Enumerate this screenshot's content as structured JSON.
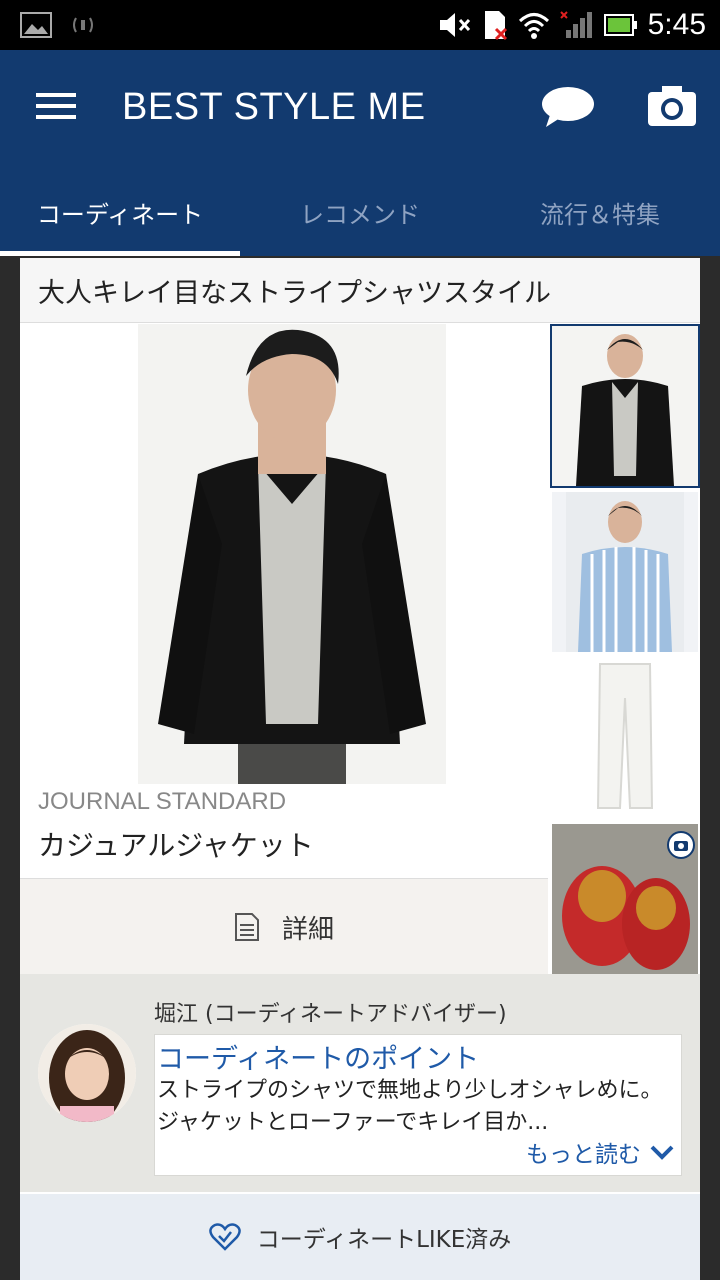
{
  "status_bar": {
    "time": "5:45"
  },
  "app": {
    "title": "BEST STYLE ME"
  },
  "tabs": [
    {
      "label": "コーディネート",
      "active": true
    },
    {
      "label": "レコメンド",
      "active": false
    },
    {
      "label": "流行＆特集",
      "active": false
    }
  ],
  "coordinate": {
    "title": "大人キレイ目なストライプシャツスタイル",
    "item": {
      "brand": "JOURNAL STANDARD",
      "name": "カジュアルジャケット"
    },
    "detail_label": "詳細",
    "thumbnails": [
      "jacket",
      "striped-shirt",
      "white-pants",
      "red-loafers"
    ]
  },
  "advisor": {
    "name": "堀江 (コーディネートアドバイザー)",
    "tip_heading": "コーディネートのポイント",
    "tip_text": "ストライプのシャツで無地より少しオシャレめに。ジャケットとローファーでキレイ目か...",
    "read_more": "もっと読む"
  },
  "like": {
    "label": "コーディネートLIKE済み"
  },
  "colors": {
    "appbar": "#123a6f",
    "link": "#1f5aa8"
  }
}
